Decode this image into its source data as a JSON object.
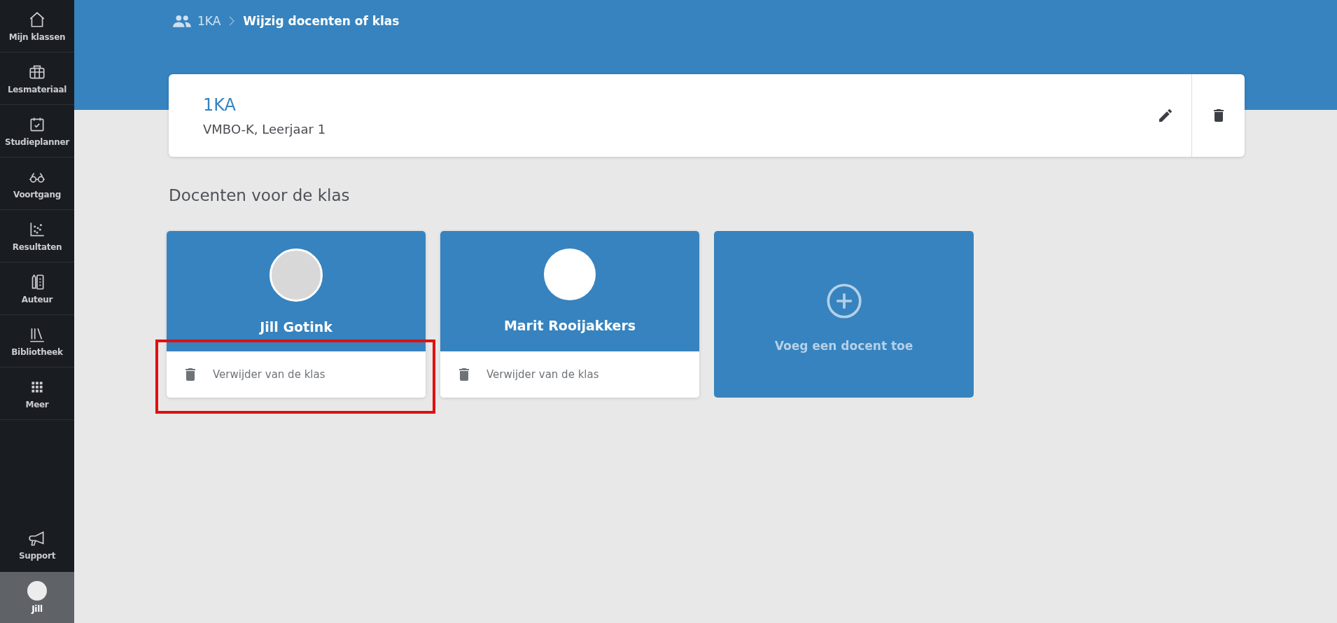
{
  "sidebar": {
    "items": [
      {
        "label": "Mijn klassen",
        "kind": "home"
      },
      {
        "label": "Lesmateriaal",
        "kind": "briefcase"
      },
      {
        "label": "Studieplanner",
        "kind": "calendar"
      },
      {
        "label": "Voortgang",
        "kind": "glasses"
      },
      {
        "label": "Resultaten",
        "kind": "scatter"
      },
      {
        "label": "Auteur",
        "kind": "pencil"
      },
      {
        "label": "Bibliotheek",
        "kind": "books"
      },
      {
        "label": "Meer",
        "kind": "grid"
      }
    ],
    "support": {
      "label": "Support"
    },
    "user": {
      "name": "Jill"
    }
  },
  "breadcrumb": {
    "class": "1KA",
    "current": "Wijzig docenten of klas"
  },
  "class_card": {
    "name": "1KA",
    "subtitle": "VMBO-K, Leerjaar 1"
  },
  "section_title": "Docenten voor de klas",
  "teachers": [
    {
      "name": "Jill Gotink",
      "kind": "photo",
      "remove_label": "Verwijder van de klas",
      "highlighted": true
    },
    {
      "name": "Marit Rooijakkers",
      "kind": "blank",
      "remove_label": "Verwijder van de klas",
      "highlighted": false
    }
  ],
  "add_teacher": {
    "label": "Voeg een docent toe"
  }
}
